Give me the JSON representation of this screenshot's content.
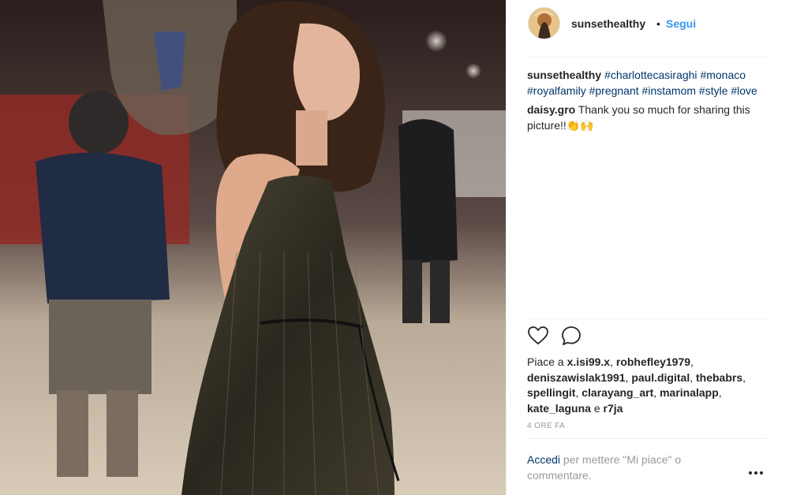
{
  "post": {
    "author": "sunsethealthy",
    "dot": "•",
    "follow_label": "Segui",
    "photo_icon": "photo"
  },
  "comments": [
    {
      "user": "sunsethealthy",
      "tags": [
        "#charlottecasiraghi",
        "#monaco",
        "#royalfamily",
        "#pregnant",
        "#instamom",
        "#style",
        "#love"
      ]
    },
    {
      "user": "daisy.gro",
      "text": "Thank you so much for sharing this picture!!👏🙌"
    }
  ],
  "actions": {
    "like_icon": "heart-icon",
    "comment_icon": "comment-icon"
  },
  "likes": {
    "prefix": "Piace a",
    "users": [
      "x.isi99.x",
      "robhefley1979",
      "deniszawislak1991",
      "paul.digital",
      "thebabrs",
      "spellingit",
      "clarayang_art",
      "marinalapp",
      "kate_laguna"
    ],
    "and_word": "e",
    "last_user": "r7ja"
  },
  "timestamp": "4 ORE FA",
  "login": {
    "link": "Accedi",
    "rest": "per mettere \"Mi piace\" o commentare."
  },
  "more_icon": "more-options-icon",
  "colors": {
    "link_blue": "#3897f0",
    "hashtag": "#003569",
    "muted": "#999999",
    "divider": "#efefef"
  }
}
